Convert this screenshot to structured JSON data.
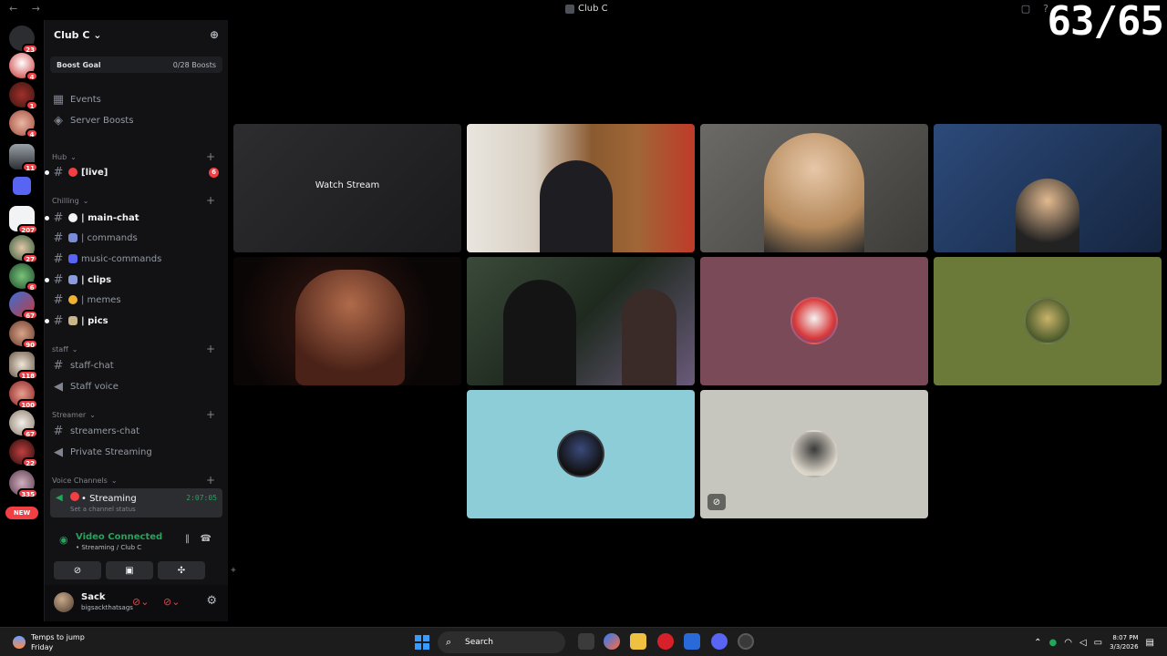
{
  "window": {
    "title": "Club C",
    "counter": "63/65"
  },
  "guild_rail": {
    "home_badge": "23",
    "badges": [
      "4",
      "1",
      "4",
      "11",
      "",
      "207",
      "27",
      "6",
      "67",
      "",
      "90",
      "118",
      "100",
      "67",
      "22",
      "335"
    ],
    "new_label": "NEW"
  },
  "server": {
    "name": "Club C",
    "boost_goal": "Boost Goal",
    "boost_count": "0/28 Boosts",
    "events": "Events",
    "server_boosts": "Server Boosts"
  },
  "categories": {
    "hub": "Hub",
    "chilling": "Chilling",
    "staff": "staff",
    "streamer": "Streamer",
    "voice": "Voice Channels"
  },
  "channels": {
    "live": "[live]",
    "live_badge": "6",
    "main_chat": "| main-chat",
    "commands": "| commands",
    "music_commands": "music-commands",
    "clips": "| clips",
    "memes": "| memes",
    "pics": "| pics",
    "staff_chat": "staff-chat",
    "staff_voice": "Staff voice",
    "streamers_chat": "streamers-chat",
    "private_streaming": "Private Streaming",
    "streaming": "• Streaming",
    "streaming_time": "2:07:05",
    "channel_status": "Set a channel status"
  },
  "voice_panel": {
    "status": "Video Connected",
    "location": "• Streaming / Club C"
  },
  "user": {
    "name": "Sack",
    "tag": "bigsackthatsags"
  },
  "stream": {
    "watch_label": "Watch Stream"
  },
  "taskbar": {
    "weather_title": "Temps to jump",
    "weather_sub": "Friday",
    "search": "Search",
    "time": "8:07 PM",
    "date": "3/3/2026"
  },
  "colors": {
    "accent": "#5865f2",
    "online": "#23a55a",
    "danger": "#f23f43",
    "sidebar": "#121214"
  }
}
